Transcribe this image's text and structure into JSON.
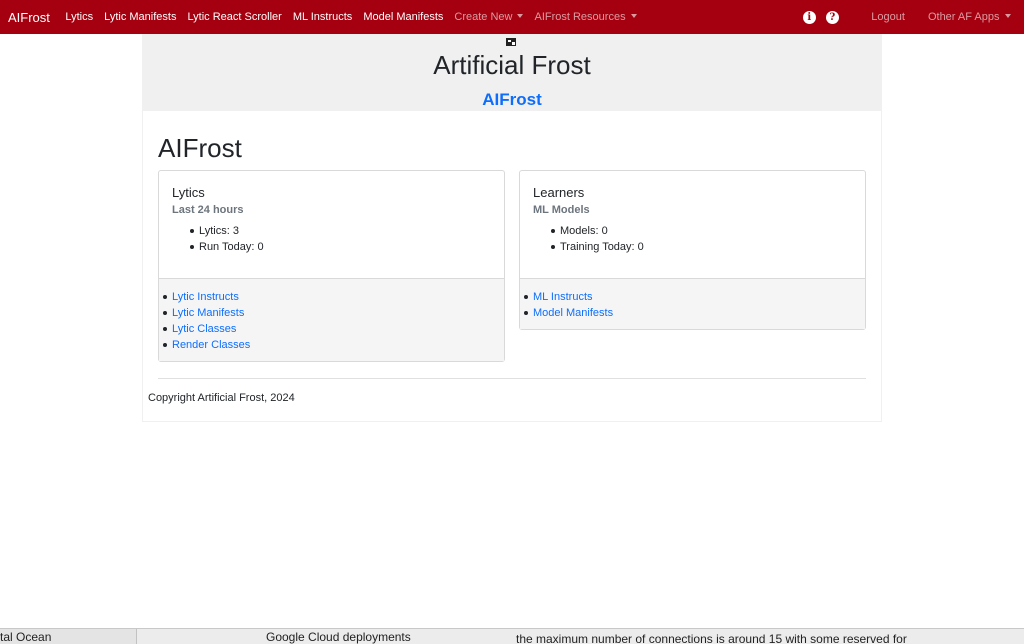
{
  "navbar": {
    "brand": "AIFrost",
    "links": [
      "Lytics",
      "Lytic Manifests",
      "Lytic React Scroller",
      "ML Instructs",
      "Model Manifests"
    ],
    "dropdowns": [
      "Create New",
      "AIFrost Resources"
    ],
    "info_icon": "info-icon",
    "help_icon": "question-icon",
    "logout": "Logout",
    "other_apps": "Other AF Apps"
  },
  "header": {
    "title": "Artificial Frost",
    "subtitle": "AIFrost"
  },
  "main": {
    "title": "AIFrost",
    "cards": [
      {
        "title": "Lytics",
        "subtitle": "Last 24 hours",
        "stats": [
          "Lytics: 3",
          "Run Today: 0"
        ],
        "links": [
          "Lytic Instructs",
          "Lytic Manifests",
          "Lytic Classes",
          "Render Classes"
        ]
      },
      {
        "title": "Learners",
        "subtitle": "ML Models",
        "stats": [
          "Models: 0",
          "Training Today: 0"
        ],
        "links": [
          "ML Instructs",
          "Model Manifests"
        ]
      }
    ],
    "copyright": "Copyright Artificial Frost, 2024"
  },
  "background_window": {
    "left_text": "tal Ocean",
    "middle_text": "Google Cloud deployments",
    "right_text": "the maximum number of connections is around 15 with some reserved for"
  },
  "colors": {
    "navbar": "#a4000f",
    "link": "#0d6efd",
    "header_band": "#f0f0f0"
  }
}
